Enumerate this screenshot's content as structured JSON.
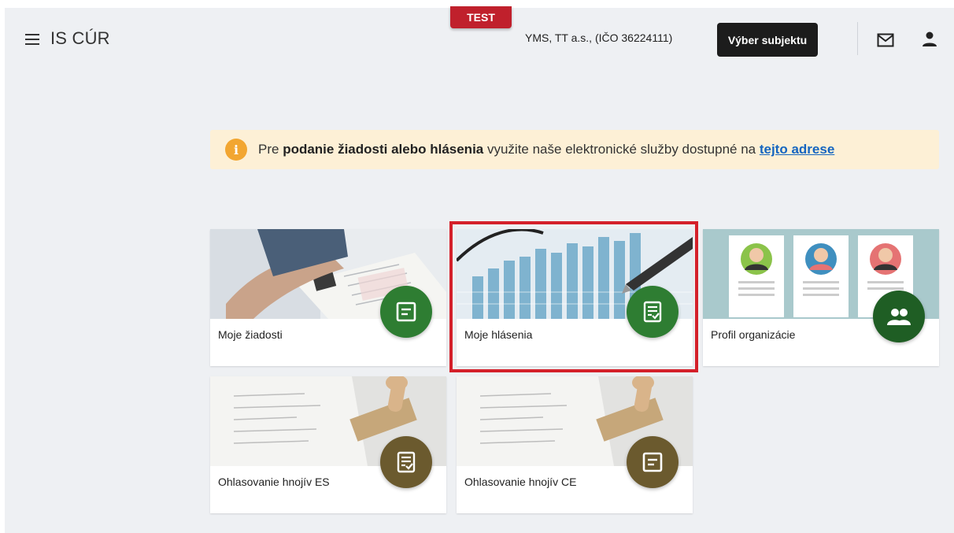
{
  "header": {
    "app_title": "IS CÚR",
    "env_badge": "TEST",
    "organization": "YMS, TT a.s., (IČO 36224111)",
    "select_subject_label": "Výber subjektu"
  },
  "banner": {
    "text_before": "Pre ",
    "text_bold": "podanie žiadosti alebo hlásenia",
    "text_after": " využite naše elektronické služby dostupné na ",
    "link_text": "tejto adrese"
  },
  "cards": [
    {
      "label": "Moje žiadosti",
      "icon": "document-icon"
    },
    {
      "label": "Moje hlásenia",
      "icon": "checklist-icon"
    },
    {
      "label": "Profil organizácie",
      "icon": "group-icon"
    },
    {
      "label": "Ohlasovanie hnojív ES",
      "icon": "checklist-icon"
    },
    {
      "label": "Ohlasovanie hnojív CE",
      "icon": "document-icon"
    }
  ],
  "colors": {
    "accent_green": "#2e7d32",
    "accent_olive": "#6b5a2e",
    "test_badge": "#c0202c",
    "highlight": "#d4202a",
    "banner_bg": "#fdf0d6",
    "link": "#1565c0"
  }
}
